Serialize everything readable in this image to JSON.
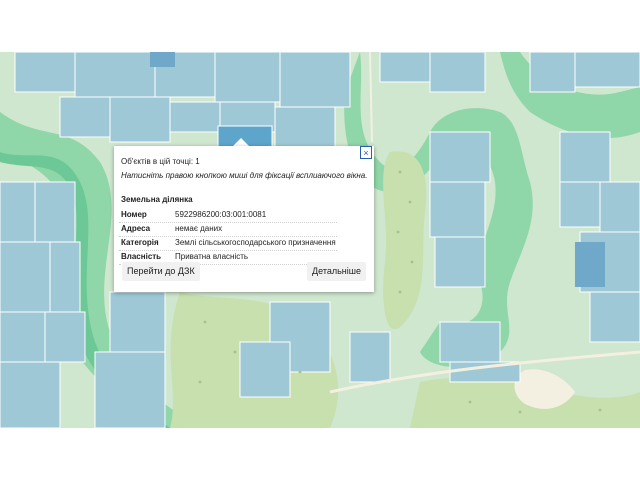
{
  "map": {
    "colors": {
      "background": "#cfe6cf",
      "parcel": "#9ec8d6",
      "parcel_selected": "#5ea5cc",
      "parcel_dark": "#6fa8c8",
      "forest": "#c8dfae",
      "river_green": "#7fd0a0",
      "road": "#f4f0e0"
    }
  },
  "popup": {
    "objects_count": "Об'єктів в цій точці: 1",
    "hint": "Натисніть правою кнопкою миші для фіксації всплиаючого вікна.",
    "section_title": "Земельна ділянка",
    "rows": [
      {
        "label": "Номер",
        "value": "5922986200:03:001:0081"
      },
      {
        "label": "Адреса",
        "value": "немає даних"
      },
      {
        "label": "Категорія",
        "value": "Землі сільськогосподарського призначення"
      },
      {
        "label": "Власність",
        "value": "Приватна власність"
      }
    ],
    "btn_dzk": "Перейти до ДЗК",
    "btn_details": "Детальніше",
    "close_icon": "×"
  }
}
